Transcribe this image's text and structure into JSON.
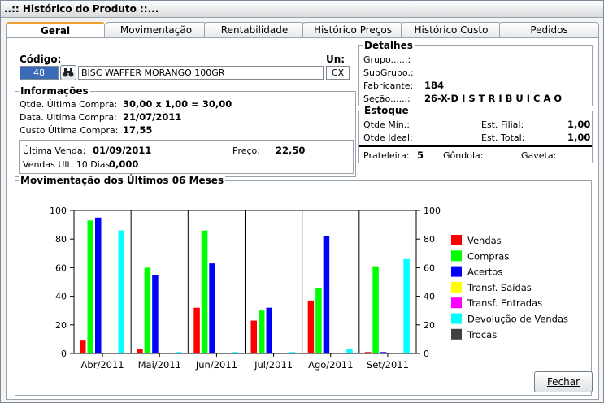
{
  "window": {
    "title": "..:: Histórico do Produto ::..."
  },
  "tabs": [
    {
      "label": "Geral",
      "active": true
    },
    {
      "label": "Movimentação",
      "active": false
    },
    {
      "label": "Rentabilidade",
      "active": false
    },
    {
      "label": "Histórico Preços",
      "active": false
    },
    {
      "label": "Histórico Custo",
      "active": false
    },
    {
      "label": "Pedidos",
      "active": false
    }
  ],
  "product": {
    "codigo_label": "Código:",
    "codigo": "48",
    "descricao": "BISC WAFFER MORANGO 100GR",
    "un_label": "Un:",
    "un": "CX",
    "search_icon": "binoculars-icon"
  },
  "informacoes": {
    "title": "Informações",
    "qtde_ultima_compra_label": "Qtde. Última Compra:",
    "qtde_ultima_compra": "30,00 x 1,00 = 30,00",
    "data_ultima_compra_label": "Data. Última Compra:",
    "data_ultima_compra": "21/07/2011",
    "custo_ultima_compra_label": "Custo Última Compra:",
    "custo_ultima_compra": "17,55",
    "ultima_venda_label": "Última Venda:",
    "ultima_venda": "01/09/2011",
    "preco_label": "Preço:",
    "preco": "22,50",
    "vendas_10_label": "Vendas Ult. 10 Dias:",
    "vendas_10": "0,000"
  },
  "detalhes": {
    "title": "Detalhes",
    "grupo_label": "Grupo......:",
    "grupo": "",
    "subgrupo_label": "SubGrupo.:",
    "subgrupo": "",
    "fabricante_label": "Fabricante:",
    "fabricante": "184",
    "secao_label": "Seção......:",
    "secao": "26-X-D I S T R I B U I C A O"
  },
  "estoque": {
    "title": "Estoque",
    "qtde_min_label": "Qtde Mín.:",
    "qtde_min": "",
    "est_filial_label": "Est. Filial:",
    "est_filial": "1,00",
    "qtde_ideal_label": "Qtde Ideal:",
    "qtde_ideal": "",
    "est_total_label": "Est. Total:",
    "est_total": "1,00",
    "prateleira_label": "Prateleira:",
    "prateleira": "5",
    "gondola_label": "Gôndola:",
    "gondola": "",
    "gaveta_label": "Gaveta:",
    "gaveta": ""
  },
  "chart_data": {
    "type": "bar",
    "title": "Movimentação dos Últimos 06 Meses",
    "categories": [
      "Abr/2011",
      "Mai/2011",
      "Jun/2011",
      "Jul/2011",
      "Ago/2011",
      "Set/2011"
    ],
    "ylim": [
      0,
      100
    ],
    "yticks": [
      0,
      20,
      40,
      60,
      80,
      100
    ],
    "grid": "vertical",
    "legend_position": "right",
    "series": [
      {
        "name": "Vendas",
        "color": "#ff0000",
        "values": [
          9,
          3,
          32,
          23,
          37,
          1
        ]
      },
      {
        "name": "Compras",
        "color": "#00ff00",
        "values": [
          93,
          60,
          86,
          30,
          46,
          61
        ]
      },
      {
        "name": "Acertos",
        "color": "#0000ff",
        "values": [
          95,
          55,
          63,
          32,
          82,
          1
        ]
      },
      {
        "name": "Transf. Saídas",
        "color": "#ffff00",
        "values": [
          0,
          0,
          0,
          0,
          0,
          0
        ]
      },
      {
        "name": "Transf. Entradas",
        "color": "#ff00ff",
        "values": [
          0,
          0,
          0,
          0,
          0,
          0
        ]
      },
      {
        "name": "Devolução de Vendas",
        "color": "#00ffff",
        "values": [
          86,
          1,
          1,
          1,
          3,
          66
        ]
      },
      {
        "name": "Trocas",
        "color": "#404040",
        "values": [
          0,
          0,
          0,
          0,
          0,
          0
        ]
      }
    ]
  },
  "footer": {
    "fechar_label": "Fechar"
  }
}
